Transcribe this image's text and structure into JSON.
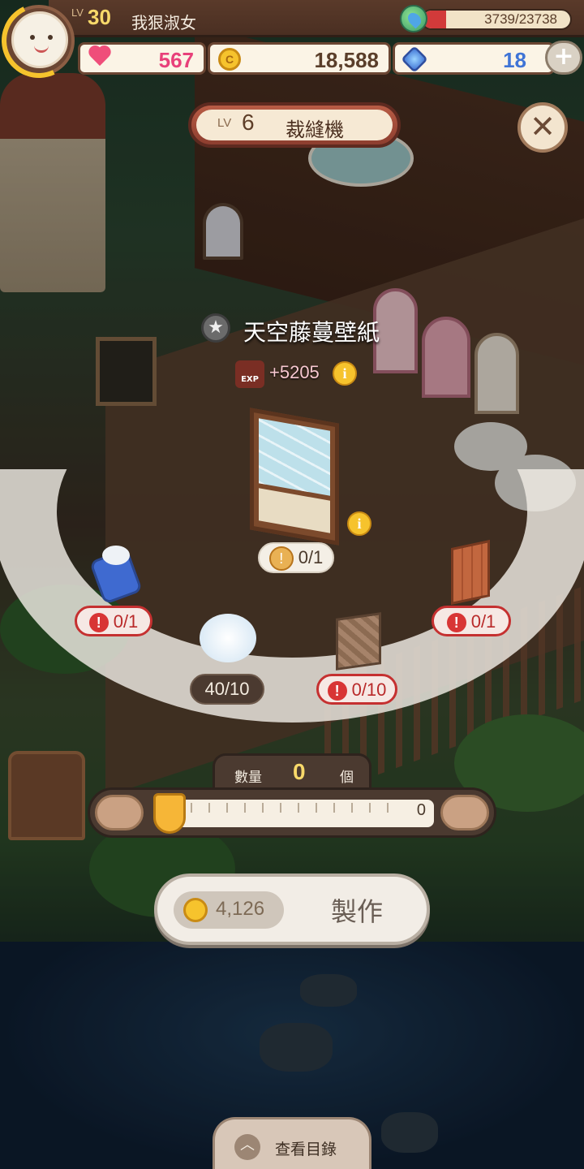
{
  "player": {
    "lv_prefix": "LV",
    "level": "30",
    "name": "我狠淑女",
    "energy_text": "3739/23738",
    "energy_fraction": 0.157
  },
  "resources": {
    "hearts": "567",
    "coins": "18,588",
    "gems": "18",
    "plus": "+"
  },
  "machine": {
    "lv_prefix": "LV",
    "level": "6",
    "name": "裁縫機",
    "close": "✕"
  },
  "product": {
    "name": "天空藤蔓壁紙",
    "exp_label": "EXP",
    "exp_value": "+5205",
    "count": "0/1",
    "info": "i"
  },
  "materials": [
    {
      "id": "fabric-roll",
      "count": "0/1",
      "style": "red"
    },
    {
      "id": "wool",
      "count": "40/10",
      "style": "dark"
    },
    {
      "id": "wood-panel",
      "count": "0/10",
      "style": "red"
    },
    {
      "id": "wood-board",
      "count": "0/1",
      "style": "red"
    }
  ],
  "quantity": {
    "label": "數量",
    "value": "0",
    "unit": "個",
    "max": "0"
  },
  "craft": {
    "cost": "4,126",
    "label": "製作"
  },
  "catalog": {
    "label": "查看目錄"
  },
  "colors": {
    "accent": "#f6c32d",
    "energy": "#d23a3a",
    "warning": "#c53030"
  }
}
